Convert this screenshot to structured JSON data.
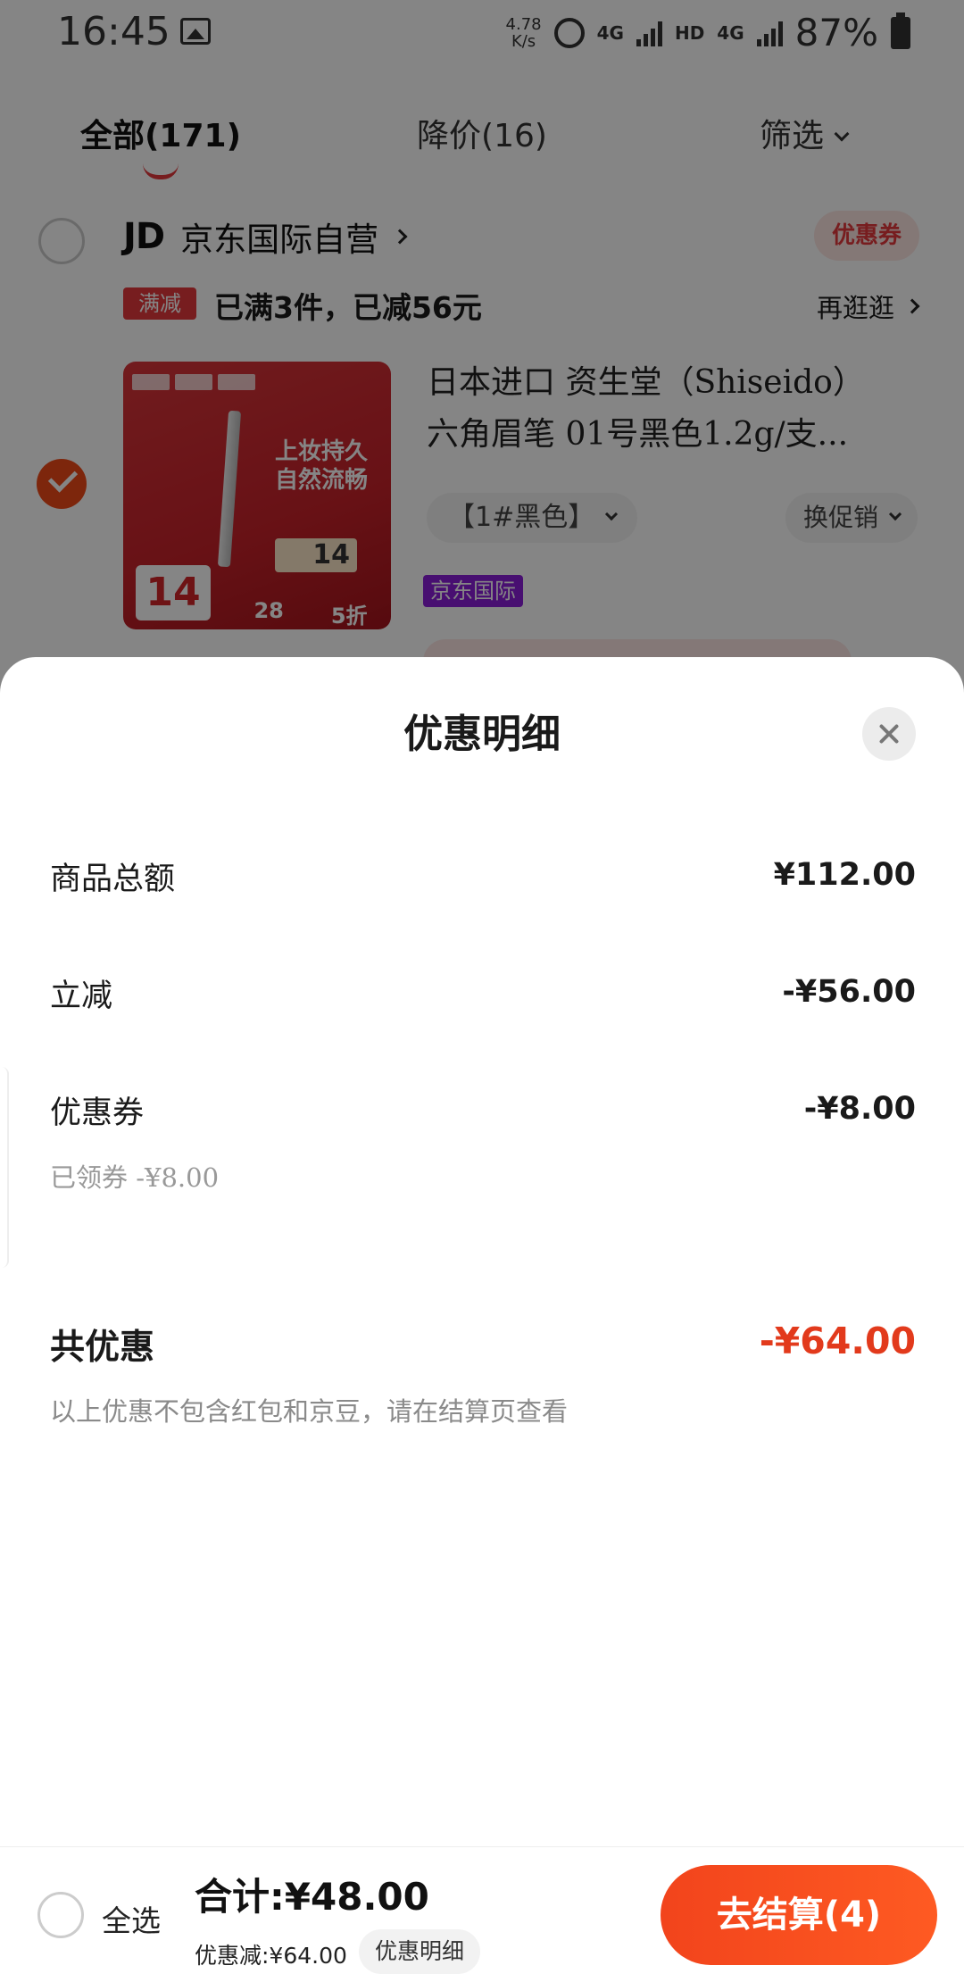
{
  "status_bar": {
    "time": "16:45",
    "net_speed_value": "4.78",
    "net_speed_unit": "K/s",
    "net_4g_1": "4G",
    "net_hd": "HD",
    "net_4g_2": "4G",
    "battery": "87%"
  },
  "tabs": [
    {
      "label": "全部(171)",
      "active": true
    },
    {
      "label": "降价(16)",
      "active": false
    },
    {
      "label": "筛选",
      "active": false
    }
  ],
  "shop": {
    "logo": "JD",
    "name": "京东国际自营",
    "coupon_tag": "优惠券",
    "promo_tag": "满减",
    "promo_text": "已满3件，已减56元",
    "promo_more": "再逛逛"
  },
  "product": {
    "title": "日本进口 资生堂（Shiseido）六角眉笔 01号黑色1.2g/支...",
    "sku": "【1#黑色】",
    "promo_switch": "换促销",
    "intl_tag": "京东国际",
    "image_text_main": "上妆持久\n自然流畅",
    "image_price_big": "14",
    "image_price_box": "14",
    "image_band_1": "28",
    "image_band_2": "5折"
  },
  "sheet": {
    "title": "优惠明细",
    "rows": [
      {
        "label": "商品总额",
        "value": "¥112.00"
      },
      {
        "label": "立减",
        "value": "-¥56.00"
      },
      {
        "label": "优惠券",
        "value": "-¥8.00",
        "sub": "已领券 -¥8.00"
      }
    ],
    "total_label": "共优惠",
    "total_value": "-¥64.00",
    "total_note": "以上优惠不包含红包和京豆，请在结算页查看"
  },
  "bottom_bar": {
    "select_all": "全选",
    "total": "合计:¥48.00",
    "discount": "优惠减:¥64.00",
    "detail_button": "优惠明细",
    "checkout": "去结算(4)"
  },
  "colors": {
    "accent_red": "#e4393c",
    "discount_red": "#e23a1c",
    "checkout_orange": "#f2441c",
    "intl_purple": "#8a1dd9"
  }
}
